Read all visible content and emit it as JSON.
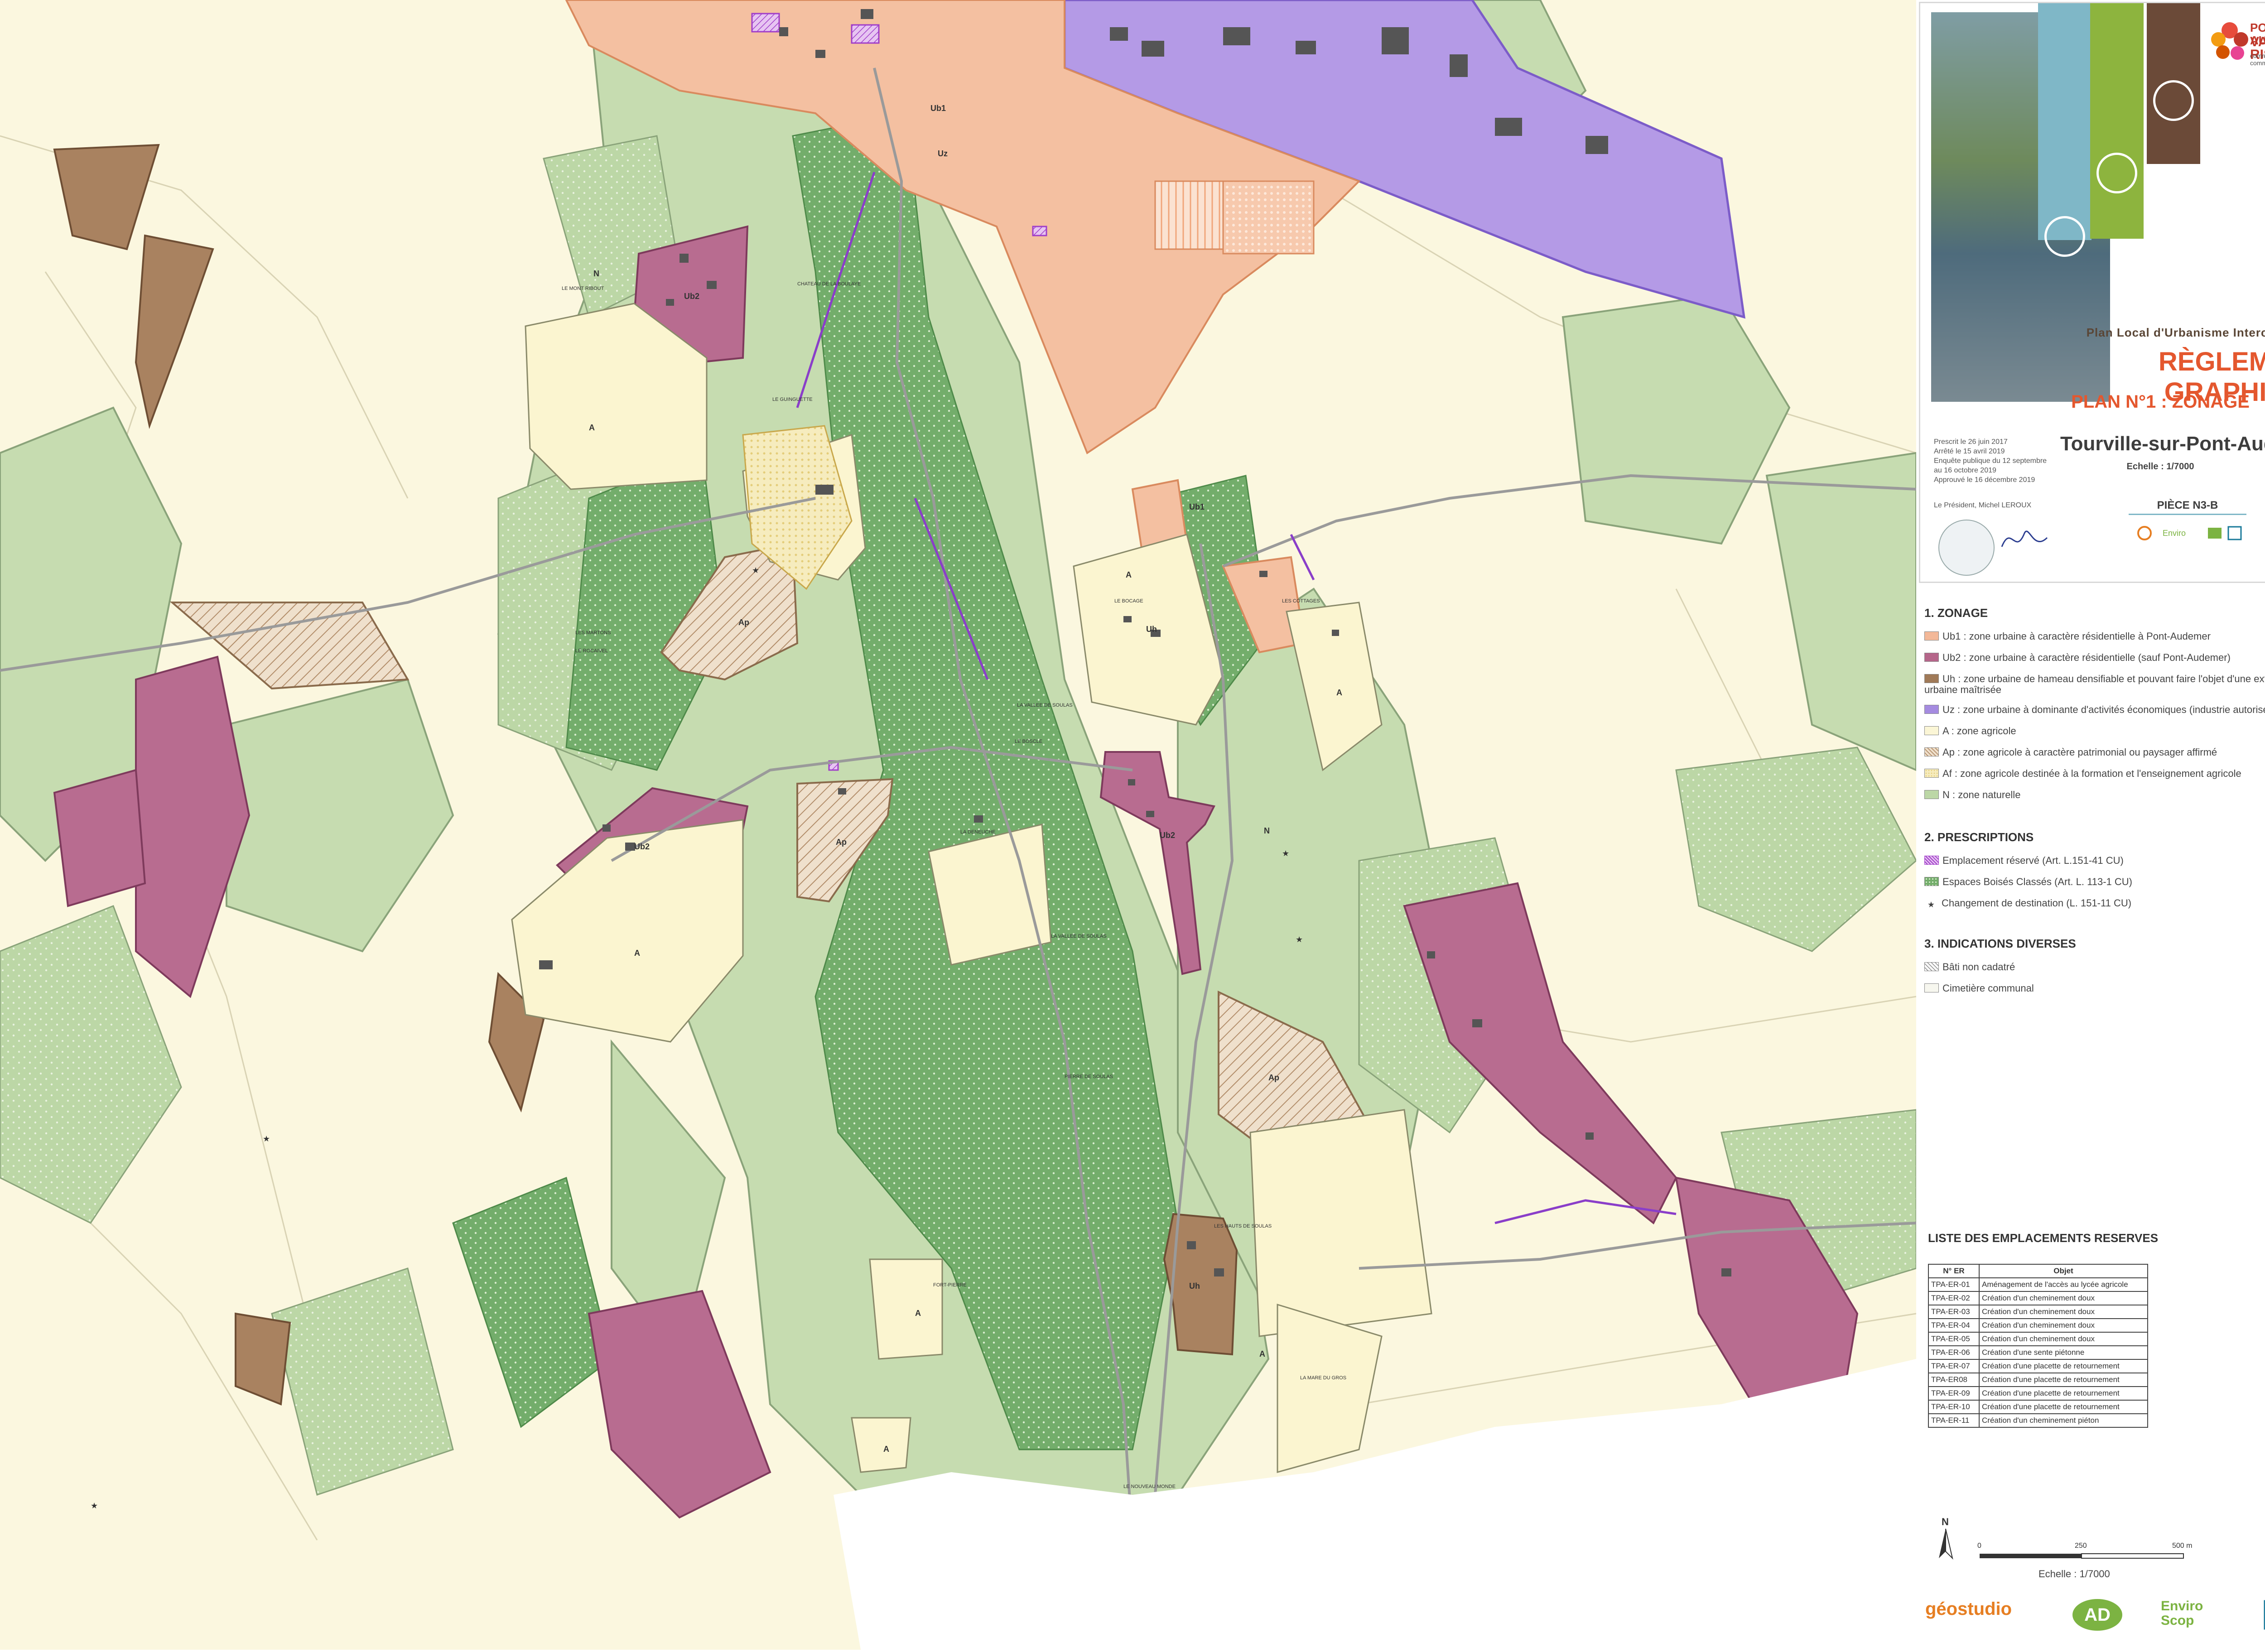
{
  "cartouche": {
    "logo_line1": "PONT-AUDEMER",
    "logo_line2": "VAL DE RISLE",
    "logo_sub": "communauté de communes",
    "document_type": "Plan Local d'Urbanisme Intercommunal",
    "title": "RÈGLEMENT GRAPHIQUE",
    "plan": "PLAN N°1 : ZONAGE",
    "commune": "Tourville-sur-Pont-Audemer",
    "scale": "Echelle : 1/7000",
    "piece": "PIÈCE N3-B",
    "dates": [
      "Prescrit le 26 juin 2017",
      "Arrêté le 15 avril 2019",
      "Enquête publique du 12 septembre",
      "au 16 octobre 2019",
      "Approuvé le 16 décembre 2019"
    ],
    "president": "Le Président, Michel LEROUX"
  },
  "legend": {
    "zonage_title": "1. ZONAGE",
    "zonage_items": [
      {
        "code": "Ub1",
        "label": "Ub1 : zone urbaine à caractère résidentielle à Pont-Audemer",
        "color": "#f3b898",
        "pattern": "solid"
      },
      {
        "code": "Ub2",
        "label": "Ub2 : zone urbaine à caractère résidentielle (sauf Pont-Audemer)",
        "color": "#b5668a",
        "pattern": "solid"
      },
      {
        "code": "Uh",
        "label": "Uh : zone urbaine de hameau densifiable et pouvant faire l'objet d'une extension urbaine maîtrisée",
        "color": "#a07a58",
        "pattern": "solid"
      },
      {
        "code": "Uz",
        "label": "Uz : zone urbaine à dominante d'activités économiques (industrie autorisée)",
        "color": "#a58be0",
        "pattern": "solid"
      },
      {
        "code": "A",
        "label": "A : zone agricole",
        "color": "#fbf6d6",
        "pattern": "solid"
      },
      {
        "code": "Ap",
        "label": "Ap : zone agricole à caractère patrimonial ou paysager affirmé",
        "color": "#f1e3cf",
        "pattern": "hatch"
      },
      {
        "code": "Af",
        "label": "Af : zone agricole destinée à la formation et l'enseignement agricole",
        "color": "#f6ecbe",
        "pattern": "dots"
      },
      {
        "code": "N",
        "label": "N : zone naturelle",
        "color": "#bcd7a6",
        "pattern": "solid"
      }
    ],
    "prescriptions_title": "2. PRESCRIPTIONS",
    "prescriptions_items": [
      {
        "label": "Emplacement réservé (Art. L.151-41 CU)",
        "color": "#a03ec9",
        "symbol": "hatch-box"
      },
      {
        "label": "Espaces Boisés Classés (Art. L. 113-1 CU)",
        "color": "#7bb47f",
        "symbol": "dots-box"
      },
      {
        "label": "Changement de destination (L. 151-11 CU)",
        "color": "#333333",
        "symbol": "star"
      }
    ],
    "indications_title": "3. INDICATIONS DIVERSES",
    "indications_items": [
      {
        "label": "Bâti non cadatré",
        "symbol": "hatch-grey"
      },
      {
        "label": "Cimetière communal",
        "symbol": "box"
      }
    ]
  },
  "reserved_table": {
    "title": "LISTE DES EMPLACEMENTS RESERVES",
    "headers": [
      "N° ER",
      "Objet"
    ],
    "rows": [
      [
        "TPA-ER-01",
        "Aménagement de l'accès au lycée agricole"
      ],
      [
        "TPA-ER-02",
        "Création d'un cheminement doux"
      ],
      [
        "TPA-ER-03",
        "Création d'un cheminement doux"
      ],
      [
        "TPA-ER-04",
        "Création d'un cheminement doux"
      ],
      [
        "TPA-ER-05",
        "Création d'un cheminement doux"
      ],
      [
        "TPA-ER-06",
        "Création d'une sente piétonne"
      ],
      [
        "TPA-ER-07",
        "Création d'une placette de retournement"
      ],
      [
        "TPA-ER08",
        "Création d'une placette de retournement"
      ],
      [
        "TPA-ER-09",
        "Création d'une placette de retournement"
      ],
      [
        "TPA-ER-10",
        "Création d'une placette de retournement"
      ],
      [
        "TPA-ER-11",
        "Création d'un cheminement piéton"
      ]
    ]
  },
  "scale_bar": {
    "ticks": [
      "0",
      "250",
      "500 m"
    ],
    "label": "Echelle : 1/7000",
    "north": "N"
  },
  "footer_logos": [
    "géostudio",
    "AD",
    "Enviro Scop"
  ],
  "map_labels": {
    "zones": [
      "Ub1",
      "Uz",
      "Ub2",
      "A",
      "Ap",
      "Ub2",
      "Ap",
      "A",
      "Uh",
      "Ub1",
      "A",
      "Ub2",
      "N",
      "Ap",
      "Uh",
      "A",
      "A",
      "A",
      "A",
      "N"
    ],
    "places": [
      "LE MONT RIBOUT",
      "CHATEAU DE LA BOULAYE",
      "LE GUINGUETTE",
      "LES MARTONS",
      "LE ROCAIVEL",
      "LE BOSCLE",
      "LA VALLEE DE SOULAS",
      "LA DENEUCHE",
      "LA VALLEE DE SOULAS",
      "PIERRE DE SOULAS",
      "FORT-PIERRE",
      "LE NOUVEAU MONDE",
      "LA MARE DU GROS",
      "LES HAUTS DE SOULAS",
      "LE BOCAGE",
      "LES COTTAGES"
    ]
  },
  "colors": {
    "ub1": "#f3b898",
    "ub2": "#b5668a",
    "uh": "#a07a58",
    "uz": "#a58be0",
    "a": "#fbf6d6",
    "n": "#bcd7a6",
    "n_dark": "#8fc27f",
    "ebc": "#6fae6a",
    "ap": "#e9d8c1",
    "road": "#cfcfcf",
    "building": "#555555"
  }
}
